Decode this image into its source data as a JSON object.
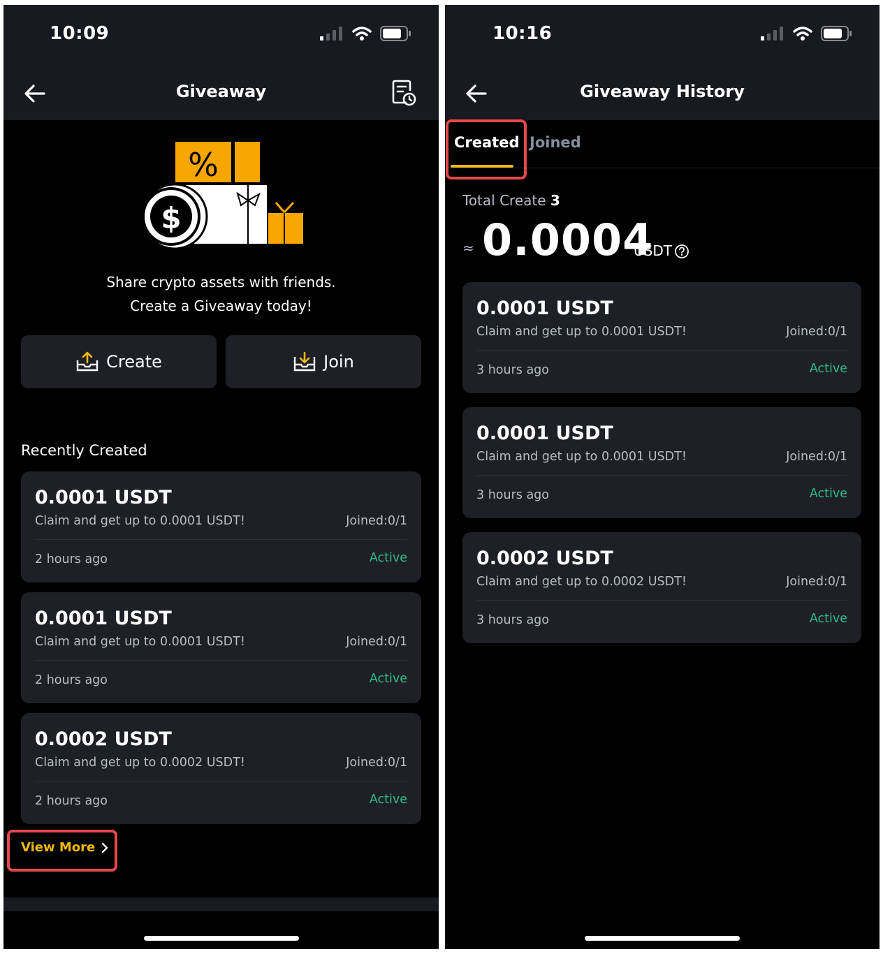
{
  "left_screen": {
    "status_time": "10:09",
    "title": "Giveaway",
    "hero_line1": "Share crypto assets with friends.",
    "hero_line2": "Create a Giveaway today!",
    "create_label": "Create",
    "join_label": "Join",
    "section_title": "Recently Created",
    "cards": [
      {
        "amount": "0.0001 USDT",
        "desc": "Claim and get up to 0.0001 USDT!",
        "joined": "Joined:0/1",
        "time": "2 hours ago",
        "status": "Active"
      },
      {
        "amount": "0.0001 USDT",
        "desc": "Claim and get up to 0.0001 USDT!",
        "joined": "Joined:0/1",
        "time": "2 hours ago",
        "status": "Active"
      },
      {
        "amount": "0.0002 USDT",
        "desc": "Claim and get up to 0.0002 USDT!",
        "joined": "Joined:0/1",
        "time": "2 hours ago",
        "status": "Active"
      }
    ],
    "view_more": "View More"
  },
  "right_screen": {
    "status_time": "10:16",
    "title": "Giveaway History",
    "tabs": [
      "Created",
      "Joined"
    ],
    "total_label": "Total Create",
    "total_count": "3",
    "approx_symbol": "≈",
    "total_value": "0.0004",
    "total_unit": "USDT",
    "cards": [
      {
        "amount": "0.0001 USDT",
        "desc": "Claim and get up to 0.0001 USDT!",
        "joined": "Joined:0/1",
        "time": "3 hours ago",
        "status": "Active"
      },
      {
        "amount": "0.0001 USDT",
        "desc": "Claim and get up to 0.0001 USDT!",
        "joined": "Joined:0/1",
        "time": "3 hours ago",
        "status": "Active"
      },
      {
        "amount": "0.0002 USDT",
        "desc": "Claim and get up to 0.0002 USDT!",
        "joined": "Joined:0/1",
        "time": "3 hours ago",
        "status": "Active"
      }
    ]
  },
  "colors": {
    "accent": "#f0b90b",
    "active_status": "#2ebd85",
    "highlight": "#e5484d",
    "card_bg": "#1e2026"
  },
  "icons": [
    "back-arrow-icon",
    "history-icon",
    "signal-icon",
    "wifi-icon",
    "battery-icon",
    "upload-icon",
    "download-icon",
    "chevron-right-icon",
    "help-icon"
  ]
}
